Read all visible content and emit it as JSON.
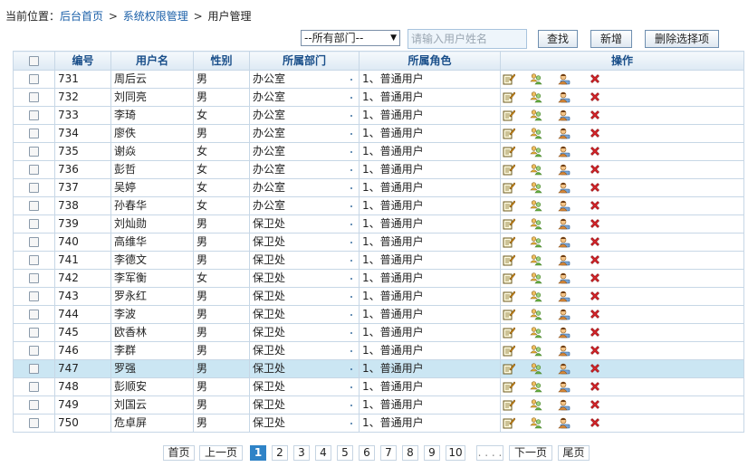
{
  "breadcrumb": {
    "prefix": "当前位置：",
    "items": [
      "后台首页",
      "系统权限管理",
      "用户管理"
    ],
    "separator": ">"
  },
  "toolbar": {
    "department_select": {
      "value": "--所有部门--"
    },
    "search": {
      "placeholder": "请输入用户姓名"
    },
    "find_label": "查找",
    "add_label": "新增",
    "delete_selected_label": "删除选择项"
  },
  "table": {
    "headers": {
      "id": "编号",
      "username": "用户名",
      "gender": "性别",
      "department": "所属部门",
      "role": "所属角色",
      "actions": "操作"
    },
    "rows": [
      {
        "id": "731",
        "name": "周后云",
        "gender": "男",
        "dept": "办公室",
        "role": "1、普通用户"
      },
      {
        "id": "732",
        "name": "刘同亮",
        "gender": "男",
        "dept": "办公室",
        "role": "1、普通用户"
      },
      {
        "id": "733",
        "name": "李琦",
        "gender": "女",
        "dept": "办公室",
        "role": "1、普通用户"
      },
      {
        "id": "734",
        "name": "廖佚",
        "gender": "男",
        "dept": "办公室",
        "role": "1、普通用户"
      },
      {
        "id": "735",
        "name": "谢焱",
        "gender": "女",
        "dept": "办公室",
        "role": "1、普通用户"
      },
      {
        "id": "736",
        "name": "彭哲",
        "gender": "女",
        "dept": "办公室",
        "role": "1、普通用户"
      },
      {
        "id": "737",
        "name": "吴婷",
        "gender": "女",
        "dept": "办公室",
        "role": "1、普通用户"
      },
      {
        "id": "738",
        "name": "孙春华",
        "gender": "女",
        "dept": "办公室",
        "role": "1、普通用户"
      },
      {
        "id": "739",
        "name": "刘灿勋",
        "gender": "男",
        "dept": "保卫处",
        "role": "1、普通用户"
      },
      {
        "id": "740",
        "name": "高维华",
        "gender": "男",
        "dept": "保卫处",
        "role": "1、普通用户"
      },
      {
        "id": "741",
        "name": "李德文",
        "gender": "男",
        "dept": "保卫处",
        "role": "1、普通用户"
      },
      {
        "id": "742",
        "name": "李军衡",
        "gender": "女",
        "dept": "保卫处",
        "role": "1、普通用户"
      },
      {
        "id": "743",
        "name": "罗永红",
        "gender": "男",
        "dept": "保卫处",
        "role": "1、普通用户"
      },
      {
        "id": "744",
        "name": "李波",
        "gender": "男",
        "dept": "保卫处",
        "role": "1、普通用户"
      },
      {
        "id": "745",
        "name": "欧香林",
        "gender": "男",
        "dept": "保卫处",
        "role": "1、普通用户"
      },
      {
        "id": "746",
        "name": "李群",
        "gender": "男",
        "dept": "保卫处",
        "role": "1、普通用户"
      },
      {
        "id": "747",
        "name": "罗强",
        "gender": "男",
        "dept": "保卫处",
        "role": "1、普通用户"
      },
      {
        "id": "748",
        "name": "彭顺安",
        "gender": "男",
        "dept": "保卫处",
        "role": "1、普通用户"
      },
      {
        "id": "749",
        "name": "刘国云",
        "gender": "男",
        "dept": "保卫处",
        "role": "1、普通用户"
      },
      {
        "id": "750",
        "name": "危卓屏",
        "gender": "男",
        "dept": "保卫处",
        "role": "1、普通用户"
      }
    ],
    "highlighted_row_id": "747",
    "row_action_icons": [
      "edit-icon",
      "assign-role-icon",
      "user-permission-icon",
      "delete-icon"
    ]
  },
  "pagination": {
    "first": "首页",
    "prev": "上一页",
    "pages": [
      "1",
      "2",
      "3",
      "4",
      "5",
      "6",
      "7",
      "8",
      "9",
      "10"
    ],
    "current": "1",
    "ellipsis": ". . . .",
    "next": "下一页",
    "last": "尾页"
  },
  "colors": {
    "header_text": "#1a4f8a",
    "link": "#1a5fa8",
    "row_highlight": "#cbe6f3",
    "current_page": "#2f83c7",
    "delete_icon": "#d9262b"
  }
}
